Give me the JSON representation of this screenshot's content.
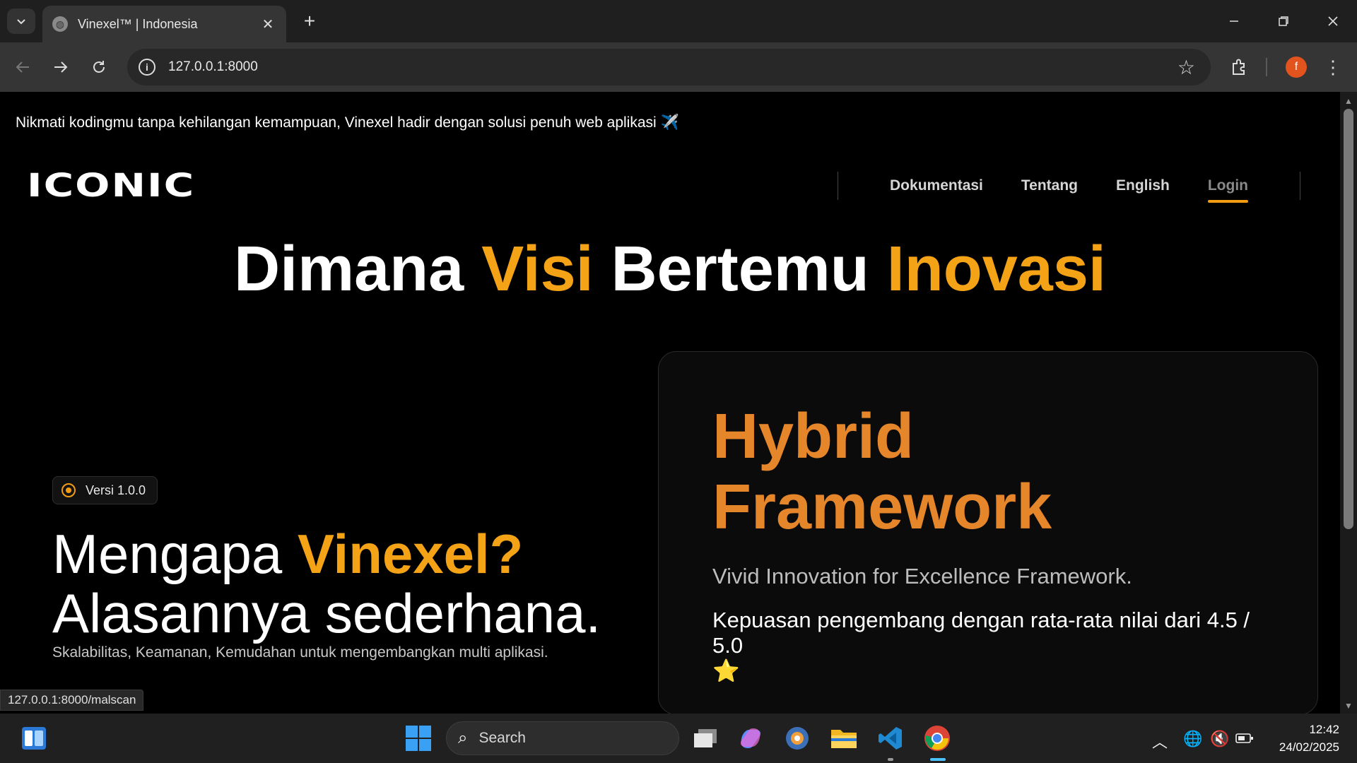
{
  "browser": {
    "tab_title": "Vinexel™ | Indonesia",
    "url": "127.0.0.1:8000",
    "profile_initial": "f",
    "status_url": "127.0.0.1:8000/malscan"
  },
  "page": {
    "announcement": "Nikmati kodingmu tanpa kehilangan kemampuan, Vinexel hadir dengan solusi penuh web aplikasi ✈️",
    "logo": "ICONIC",
    "nav": [
      "Dokumentasi",
      "Tentang",
      "English",
      "Login"
    ],
    "hero": {
      "w1": "Dimana ",
      "w2": "Visi",
      "w3": " Bertemu ",
      "w4": "Inovasi"
    },
    "badge": "Versi 1.0.0",
    "why": {
      "a": "Mengapa ",
      "b": "Vinexel?",
      "c": "Alasannya sederhana."
    },
    "why_sub": "Skalabilitas, Keamanan, Kemudahan untuk mengembangkan multi aplikasi.",
    "card": {
      "line1": "Hybrid",
      "line2": "Framework",
      "subtitle": "Vivid Innovation for Excellence Framework.",
      "rating": "Kepuasan pengembang dengan rata-rata nilai dari 4.5 / 5.0",
      "rating_icon": "⭐"
    }
  },
  "taskbar": {
    "search_placeholder": "Search",
    "time": "12:42",
    "date": "24/02/2025"
  },
  "colors": {
    "accent": "#f5a316",
    "card_title": "#e6862b"
  }
}
